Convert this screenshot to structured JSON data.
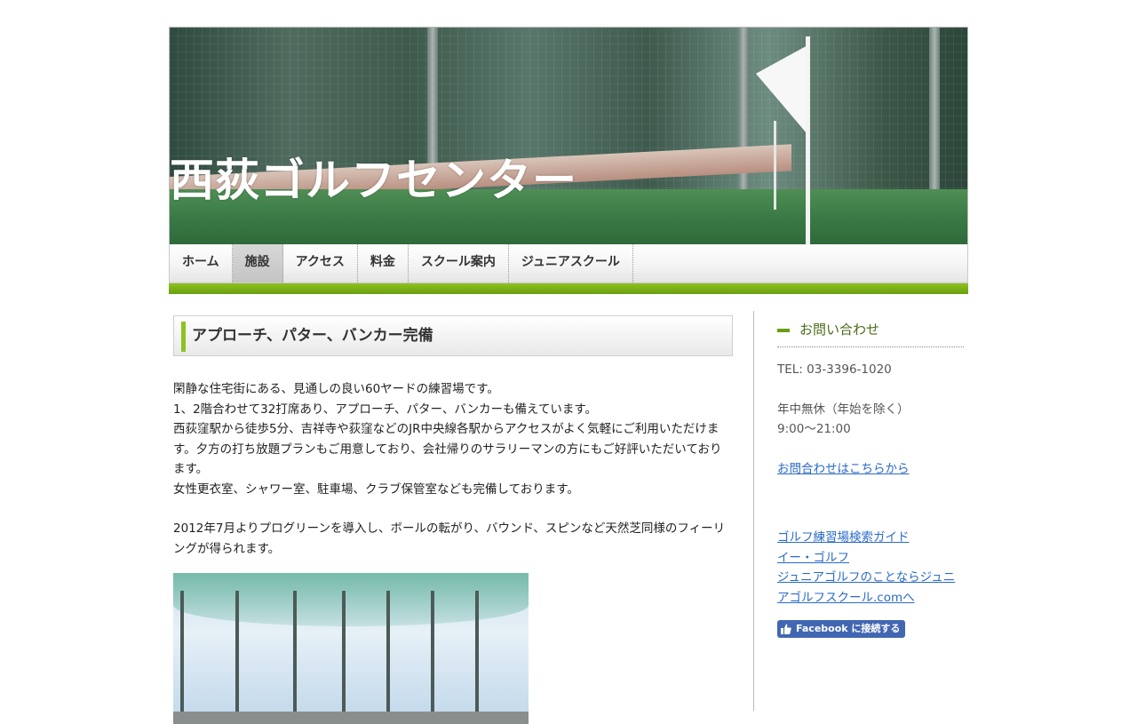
{
  "header": {
    "site_title": "西荻ゴルフセンター"
  },
  "nav": {
    "items": [
      {
        "label": "ホーム"
      },
      {
        "label": "施設",
        "active": true
      },
      {
        "label": "アクセス"
      },
      {
        "label": "料金"
      },
      {
        "label": "スクール案内"
      },
      {
        "label": "ジュニアスクール"
      }
    ]
  },
  "main": {
    "heading": "アプローチ、パター、バンカー完備",
    "paragraph1": [
      "閑静な住宅街にある、見通しの良い60ヤードの練習場です。",
      "1、2階合わせて32打席あり、アプローチ、パター、バンカーも備えています。",
      "西荻窪駅から徒歩5分、吉祥寺や荻窪などのJR中央線各駅からアクセスがよく気軽にご利用いただけます。夕方の打ち放題プランもご用意しており、会社帰りのサラリーマンの方にもご好評いただいております。",
      "女性更衣室、シャワー室、駐車場、クラブ保管室なども完備しております。"
    ],
    "paragraph2": "2012年7月よりプログリーンを導入し、ボールの転がり、バウンド、スピンなど天然芝同様のフィーリングが得られます。"
  },
  "sidebar": {
    "title": "お問い合わせ",
    "tel": "TEL: 03-3396-1020",
    "hours_note": "年中無休（年始を除く）",
    "hours": "9:00～21:00",
    "contact_link": "お問合わせはこちらから",
    "links": [
      "ゴルフ練習場検索ガイド",
      "イー・ゴルフ",
      "ジュニアゴルフのことならジュニアゴルフスクール.comへ"
    ],
    "facebook_label": "Facebook に接続する"
  },
  "colors": {
    "accent_green": "#8dc21f",
    "link_blue": "#2a6bc9",
    "facebook_blue": "#4267b2"
  }
}
